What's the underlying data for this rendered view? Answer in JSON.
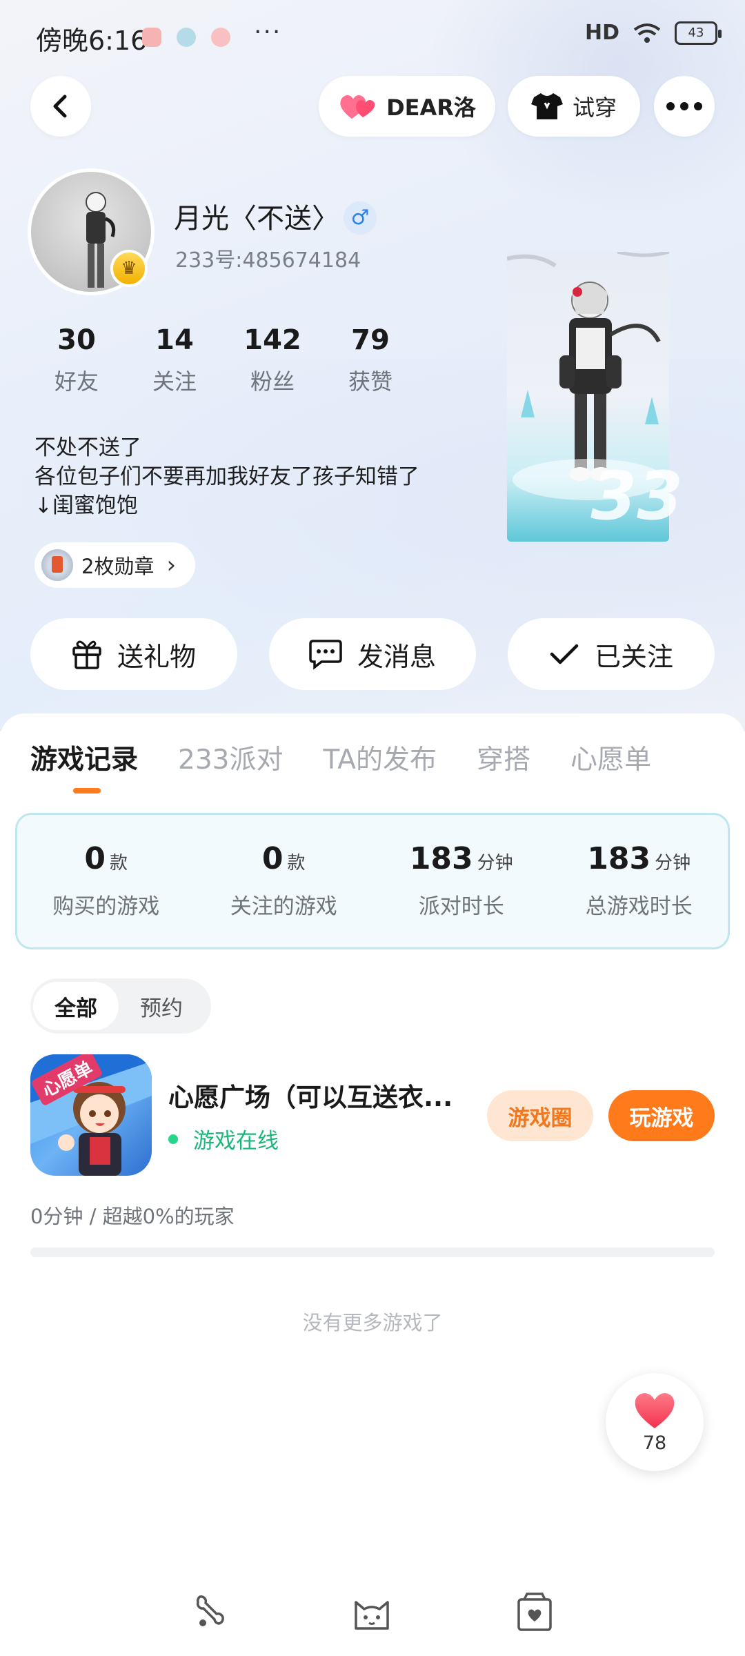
{
  "status_bar": {
    "time": "傍晚6:16",
    "dots": "···",
    "signal": "HD",
    "battery": "43"
  },
  "header": {
    "dear_label": "DEAR洛",
    "try_on_label": "试穿"
  },
  "profile": {
    "name": "月光〈不送〉",
    "gender_symbol": "♂",
    "uid": "233号:485674184",
    "stats": [
      {
        "value": "30",
        "label": "好友"
      },
      {
        "value": "14",
        "label": "关注"
      },
      {
        "value": "142",
        "label": "粉丝"
      },
      {
        "value": "79",
        "label": "获赞"
      }
    ],
    "bio_lines": [
      "不处不送了",
      "各位包子们不要再加我好友了孩子知错了",
      "↓闺蜜饱饱"
    ],
    "medal_label": "2枚勋章",
    "medal_chevron": "›",
    "watermark": "33"
  },
  "actions": {
    "gift": "送礼物",
    "message": "发消息",
    "followed": "已关注"
  },
  "tabs": [
    "游戏记录",
    "233派对",
    "TA的发布",
    "穿搭",
    "心愿单"
  ],
  "game_stats": [
    {
      "value": "0",
      "unit": "款",
      "label": "购买的游戏"
    },
    {
      "value": "0",
      "unit": "款",
      "label": "关注的游戏"
    },
    {
      "value": "183",
      "unit": "分钟",
      "label": "派对时长"
    },
    {
      "value": "183",
      "unit": "分钟",
      "label": "总游戏时长"
    }
  ],
  "filter": {
    "all": "全部",
    "reserved": "预约"
  },
  "game": {
    "title": "心愿广场（可以互送衣...",
    "icon_text": "心愿单",
    "status": "游戏在线",
    "circle_label": "游戏圈",
    "play_label": "玩游戏",
    "playtime": "0分钟 / 超越0%的玩家",
    "progress_fraction": 0
  },
  "no_more": "没有更多游戏了",
  "like_count": "78",
  "colors": {
    "accent": "#ff7a1a",
    "online": "#1bb77a",
    "gender": "#2d84e8"
  }
}
